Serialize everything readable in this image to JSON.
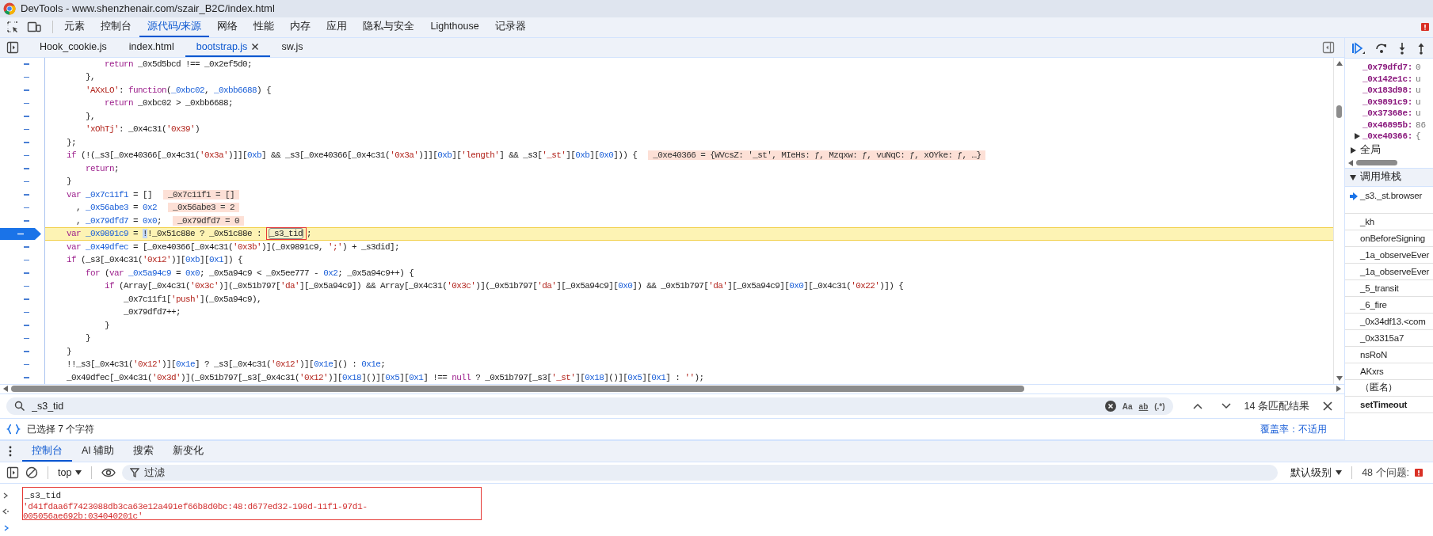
{
  "window": {
    "title": "DevTools - www.shenzhenair.com/szair_B2C/index.html"
  },
  "panel_tabs": [
    {
      "label": "元素",
      "selected": false
    },
    {
      "label": "控制台",
      "selected": false
    },
    {
      "label": "源代码/来源",
      "selected": true
    },
    {
      "label": "网络",
      "selected": false
    },
    {
      "label": "性能",
      "selected": false
    },
    {
      "label": "内存",
      "selected": false
    },
    {
      "label": "应用",
      "selected": false
    },
    {
      "label": "隐私与安全",
      "selected": false
    },
    {
      "label": "Lighthouse",
      "selected": false
    },
    {
      "label": "记录器",
      "selected": false
    }
  ],
  "file_tabs": [
    {
      "label": "Hook_cookie.js",
      "selected": false,
      "closable": false
    },
    {
      "label": "index.html",
      "selected": false,
      "closable": false
    },
    {
      "label": "bootstrap.js",
      "selected": true,
      "closable": true
    },
    {
      "label": "sw.js",
      "selected": false,
      "closable": false
    }
  ],
  "code": {
    "lines": [
      {
        "tokens": [
          {
            "kind": "keyword",
            "text": "        return"
          },
          {
            "kind": "plain",
            "text": " _0x5d5bcd !== _0x2ef5d0;"
          }
        ]
      },
      {
        "tokens": [
          {
            "kind": "plain",
            "text": "    },"
          }
        ]
      },
      {
        "tokens": [
          {
            "kind": "string",
            "text": "    'AXxLO'"
          },
          {
            "kind": "plain",
            "text": ": "
          },
          {
            "kind": "keyword",
            "text": "function"
          },
          {
            "kind": "plain",
            "text": "("
          },
          {
            "kind": "name",
            "text": "_0xbc02"
          },
          {
            "kind": "plain",
            "text": ", "
          },
          {
            "kind": "name",
            "text": "_0xbb6688"
          },
          {
            "kind": "plain",
            "text": ") {"
          }
        ]
      },
      {
        "tokens": [
          {
            "kind": "keyword",
            "text": "        return"
          },
          {
            "kind": "plain",
            "text": " _0xbc02 > _0xbb6688;"
          }
        ]
      },
      {
        "tokens": [
          {
            "kind": "plain",
            "text": "    },"
          }
        ]
      },
      {
        "tokens": [
          {
            "kind": "string",
            "text": "    'xOhTj'"
          },
          {
            "kind": "plain",
            "text": ": _0x4c31("
          },
          {
            "kind": "string",
            "text": "'0x39'"
          },
          {
            "kind": "plain",
            "text": ")"
          }
        ]
      },
      {
        "tokens": [
          {
            "kind": "plain",
            "text": "};"
          }
        ]
      },
      {
        "tokens": [
          {
            "kind": "keyword",
            "text": "if"
          },
          {
            "kind": "plain",
            "text": " (!(_s3[_0xe40366[_0x4c31("
          },
          {
            "kind": "string",
            "text": "'0x3a'"
          },
          {
            "kind": "plain",
            "text": ")]]["
          },
          {
            "kind": "number",
            "text": "0xb"
          },
          {
            "kind": "plain",
            "text": "] && _s3[_0xe40366[_0x4c31("
          },
          {
            "kind": "string",
            "text": "'0x3a'"
          },
          {
            "kind": "plain",
            "text": ")]]["
          },
          {
            "kind": "number",
            "text": "0xb"
          },
          {
            "kind": "plain",
            "text": "]["
          },
          {
            "kind": "string",
            "text": "'length'"
          },
          {
            "kind": "plain",
            "text": "] && _s3["
          },
          {
            "kind": "string",
            "text": "'_st'"
          },
          {
            "kind": "plain",
            "text": "]["
          },
          {
            "kind": "number",
            "text": "0xb"
          },
          {
            "kind": "plain",
            "text": "]["
          },
          {
            "kind": "number",
            "text": "0x0"
          },
          {
            "kind": "plain",
            "text": "])) {"
          }
        ],
        "inline_value": "_0xe40366 = {WVcsZ: '_st', MIeHs: ƒ, Mzqxw: ƒ, vuNqC: ƒ, xOYke: ƒ, …}"
      },
      {
        "tokens": [
          {
            "kind": "keyword",
            "text": "    return"
          },
          {
            "kind": "plain",
            "text": ";"
          }
        ]
      },
      {
        "tokens": [
          {
            "kind": "plain",
            "text": "}"
          }
        ]
      },
      {
        "tokens": [
          {
            "kind": "keyword",
            "text": "var "
          },
          {
            "kind": "name",
            "text": "_0x7c11f1"
          },
          {
            "kind": "plain",
            "text": " = []"
          }
        ],
        "inline_value": "_0x7c11f1 = []"
      },
      {
        "tokens": [
          {
            "kind": "plain",
            "text": "  , "
          },
          {
            "kind": "name",
            "text": "_0x56abe3"
          },
          {
            "kind": "plain",
            "text": " = "
          },
          {
            "kind": "number",
            "text": "0x2"
          }
        ],
        "inline_value": "_0x56abe3 = 2"
      },
      {
        "tokens": [
          {
            "kind": "plain",
            "text": "  , "
          },
          {
            "kind": "name",
            "text": "_0x79dfd7"
          },
          {
            "kind": "plain",
            "text": " = "
          },
          {
            "kind": "number",
            "text": "0x0"
          },
          {
            "kind": "plain",
            "text": ";"
          }
        ],
        "inline_value": "_0x79dfd7 = 0"
      },
      {
        "tokens": [
          {
            "kind": "keyword",
            "text": "var "
          },
          {
            "kind": "name",
            "text": "_0x9891c9"
          },
          {
            "kind": "plain",
            "text": " = "
          },
          {
            "kind": "selection",
            "text": "!"
          },
          {
            "kind": "plain",
            "text": "!_0x51c88e ? _0x51c88e : "
          },
          {
            "kind": "match",
            "text": "_s3_tid",
            "framed": true
          },
          {
            "kind": "plain",
            "text": ";"
          }
        ],
        "current": true,
        "breakpoint": true
      },
      {
        "tokens": [
          {
            "kind": "keyword",
            "text": "var "
          },
          {
            "kind": "name",
            "text": "_0x49dfec"
          },
          {
            "kind": "plain",
            "text": " = [_0xe40366[_0x4c31("
          },
          {
            "kind": "string",
            "text": "'0x3b'"
          },
          {
            "kind": "plain",
            "text": ")](_0x9891c9, "
          },
          {
            "kind": "string",
            "text": "';'"
          },
          {
            "kind": "plain",
            "text": ") + _s3did];"
          }
        ]
      },
      {
        "tokens": [
          {
            "kind": "keyword",
            "text": "if"
          },
          {
            "kind": "plain",
            "text": " (_s3[_0x4c31("
          },
          {
            "kind": "string",
            "text": "'0x12'"
          },
          {
            "kind": "plain",
            "text": ")]["
          },
          {
            "kind": "number",
            "text": "0xb"
          },
          {
            "kind": "plain",
            "text": "]["
          },
          {
            "kind": "number",
            "text": "0x1"
          },
          {
            "kind": "plain",
            "text": "]) {"
          }
        ]
      },
      {
        "tokens": [
          {
            "kind": "keyword",
            "text": "    for"
          },
          {
            "kind": "plain",
            "text": " ("
          },
          {
            "kind": "keyword",
            "text": "var "
          },
          {
            "kind": "name",
            "text": "_0x5a94c9"
          },
          {
            "kind": "plain",
            "text": " = "
          },
          {
            "kind": "number",
            "text": "0x0"
          },
          {
            "kind": "plain",
            "text": "; _0x5a94c9 < _0x5ee777 - "
          },
          {
            "kind": "number",
            "text": "0x2"
          },
          {
            "kind": "plain",
            "text": "; _0x5a94c9++) {"
          }
        ]
      },
      {
        "tokens": [
          {
            "kind": "keyword",
            "text": "        if"
          },
          {
            "kind": "plain",
            "text": " (Array[_0x4c31("
          },
          {
            "kind": "string",
            "text": "'0x3c'"
          },
          {
            "kind": "plain",
            "text": ")](_0x51b797["
          },
          {
            "kind": "string",
            "text": "'da'"
          },
          {
            "kind": "plain",
            "text": "][_0x5a94c9]) && Array[_0x4c31("
          },
          {
            "kind": "string",
            "text": "'0x3c'"
          },
          {
            "kind": "plain",
            "text": ")](_0x51b797["
          },
          {
            "kind": "string",
            "text": "'da'"
          },
          {
            "kind": "plain",
            "text": "][_0x5a94c9]["
          },
          {
            "kind": "number",
            "text": "0x0"
          },
          {
            "kind": "plain",
            "text": "]) && _0x51b797["
          },
          {
            "kind": "string",
            "text": "'da'"
          },
          {
            "kind": "plain",
            "text": "][_0x5a94c9]["
          },
          {
            "kind": "number",
            "text": "0x0"
          },
          {
            "kind": "plain",
            "text": "][_0x4c31("
          },
          {
            "kind": "string",
            "text": "'0x22'"
          },
          {
            "kind": "plain",
            "text": ")]) {"
          }
        ]
      },
      {
        "tokens": [
          {
            "kind": "plain",
            "text": "            _0x7c11f1["
          },
          {
            "kind": "string",
            "text": "'push'"
          },
          {
            "kind": "plain",
            "text": "](_0x5a94c9),"
          }
        ]
      },
      {
        "tokens": [
          {
            "kind": "plain",
            "text": "            _0x79dfd7++;"
          }
        ]
      },
      {
        "tokens": [
          {
            "kind": "plain",
            "text": "        }"
          }
        ]
      },
      {
        "tokens": [
          {
            "kind": "plain",
            "text": "    }"
          }
        ]
      },
      {
        "tokens": [
          {
            "kind": "plain",
            "text": "}"
          }
        ]
      },
      {
        "tokens": [
          {
            "kind": "plain",
            "text": "!!_s3[_0x4c31("
          },
          {
            "kind": "string",
            "text": "'0x12'"
          },
          {
            "kind": "plain",
            "text": ")]["
          },
          {
            "kind": "number",
            "text": "0x1e"
          },
          {
            "kind": "plain",
            "text": "] ? _s3[_0x4c31("
          },
          {
            "kind": "string",
            "text": "'0x12'"
          },
          {
            "kind": "plain",
            "text": ")]["
          },
          {
            "kind": "number",
            "text": "0x1e"
          },
          {
            "kind": "plain",
            "text": "]() : "
          },
          {
            "kind": "number",
            "text": "0x1e"
          },
          {
            "kind": "plain",
            "text": ";"
          }
        ]
      },
      {
        "tokens": [
          {
            "kind": "plain",
            "text": "_0x49dfec[_0x4c31("
          },
          {
            "kind": "string",
            "text": "'0x3d'"
          },
          {
            "kind": "plain",
            "text": ")](_0x51b797[_s3[_0x4c31("
          },
          {
            "kind": "string",
            "text": "'0x12'"
          },
          {
            "kind": "plain",
            "text": ")]["
          },
          {
            "kind": "number",
            "text": "0x18"
          },
          {
            "kind": "plain",
            "text": "]()]["
          },
          {
            "kind": "number",
            "text": "0x5"
          },
          {
            "kind": "plain",
            "text": "]["
          },
          {
            "kind": "number",
            "text": "0x1"
          },
          {
            "kind": "plain",
            "text": "] !== "
          },
          {
            "kind": "keyword",
            "text": "null"
          },
          {
            "kind": "plain",
            "text": " ? _0x51b797[_s3["
          },
          {
            "kind": "string",
            "text": "'_st'"
          },
          {
            "kind": "plain",
            "text": "]["
          },
          {
            "kind": "number",
            "text": "0x18"
          },
          {
            "kind": "plain",
            "text": "]()]["
          },
          {
            "kind": "number",
            "text": "0x5"
          },
          {
            "kind": "plain",
            "text": "]["
          },
          {
            "kind": "number",
            "text": "0x1"
          },
          {
            "kind": "plain",
            "text": "] : "
          },
          {
            "kind": "string",
            "text": "''"
          },
          {
            "kind": "plain",
            "text": ");"
          }
        ]
      }
    ]
  },
  "search": {
    "value": "_s3_tid",
    "options": [
      {
        "label": "Aa"
      },
      {
        "label": "ab"
      },
      {
        "label": "(.*)"
      }
    ],
    "match_count": "14 条匹配结果"
  },
  "status_bar": {
    "selection": "已选择 7 个字符",
    "coverage": "覆盖率：不适用"
  },
  "scope": {
    "variables": [
      {
        "name": "_0x79dfd7:",
        "value": "0",
        "expandable": false
      },
      {
        "name": "_0x142e1c:",
        "value": "u",
        "expandable": false
      },
      {
        "name": "_0x183d98:",
        "value": "u",
        "expandable": false
      },
      {
        "name": "_0x9891c9:",
        "value": "u",
        "expandable": false
      },
      {
        "name": "_0x37368e:",
        "value": "u",
        "expandable": false
      },
      {
        "name": "_0x46895b:",
        "value": "86",
        "expandable": false
      },
      {
        "name": "_0xe40366:",
        "value": "{",
        "expandable": true
      }
    ],
    "global": {
      "label": "全局",
      "expanded": false
    }
  },
  "call_stack": {
    "label": "调用堆栈",
    "expanded": true,
    "frames": [
      {
        "name": "_s3._st.browser",
        "selected": true,
        "kind": "frame"
      },
      {
        "name": "_kh",
        "selected": false,
        "kind": "frame"
      },
      {
        "name": "onBeforeSigning",
        "selected": false,
        "kind": "frame"
      },
      {
        "name": "_1a_observeEver",
        "selected": false,
        "kind": "frame"
      },
      {
        "name": "_1a_observeEver",
        "selected": false,
        "kind": "frame"
      },
      {
        "name": "_5_transit",
        "selected": false,
        "kind": "frame"
      },
      {
        "name": "_6_fire",
        "selected": false,
        "kind": "frame"
      },
      {
        "name": "_0x34df13.<com",
        "selected": false,
        "kind": "frame"
      },
      {
        "name": "_0x3315a7",
        "selected": false,
        "kind": "frame"
      },
      {
        "name": "nsRoN",
        "selected": false,
        "kind": "frame"
      },
      {
        "name": "AKxrs",
        "selected": false,
        "kind": "frame"
      },
      {
        "name": "（匿名）",
        "selected": false,
        "kind": "frame"
      },
      {
        "name": "setTimeout",
        "selected": false,
        "kind": "async"
      }
    ]
  },
  "drawer": {
    "tabs": [
      {
        "label": "控制台",
        "selected": true
      },
      {
        "label": "AI 辅助",
        "selected": false
      },
      {
        "label": "搜索",
        "selected": false
      },
      {
        "label": "新变化",
        "selected": false
      }
    ],
    "context": "top",
    "filter_placeholder": "过滤",
    "level": "默认级别",
    "issues": "48 个问题:"
  },
  "console": {
    "framed": true,
    "entries": [
      {
        "kind": "input",
        "text": "_s3_tid"
      },
      {
        "kind": "result",
        "text": "'d41fdaa6f7423088db3ca63e12a491ef66b8d0bc:48:d677ed32-190d-11f1-97d1-005056ae692b:034040201c'"
      }
    ]
  }
}
